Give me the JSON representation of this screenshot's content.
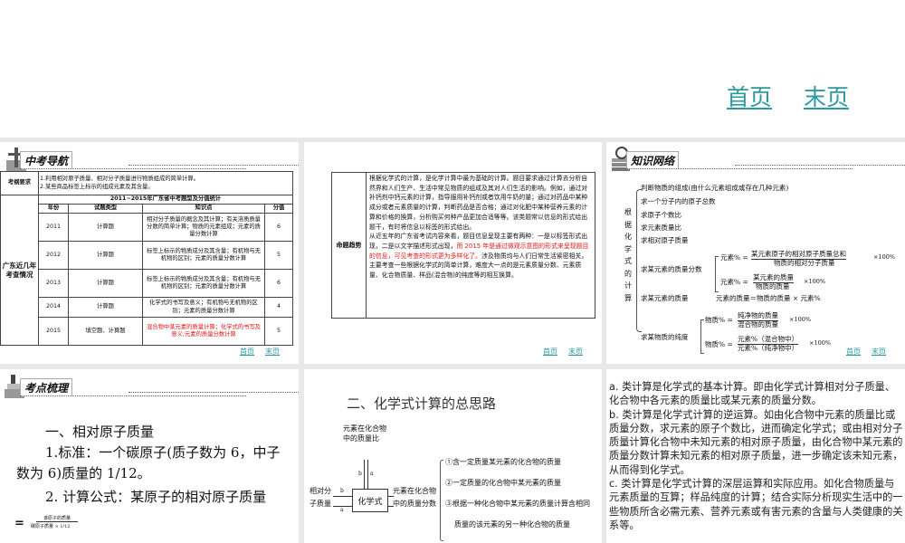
{
  "nav": {
    "first": "首页",
    "last": "末页"
  },
  "slide1": {
    "header": "中考导航",
    "req_label": "考纲要求",
    "req": [
      "1.利用相对原子质量、相对分子质量进行物质组成的简单计算。",
      "2.某些商品标签上标示的组成元素及其含量。"
    ],
    "side_label": "广东近几年考查情况",
    "table_title": "2011~2015年广东省中考题型及分值统计",
    "columns": [
      "年份",
      "试题类型",
      "知识点",
      "分值"
    ],
    "rows": [
      {
        "year": "2011",
        "type": "计算题",
        "point": "相对分子质量的概念及其计算；有关溶质质量分数的简单计算；物质的元素组成；元素的质量分数计算",
        "score": "6"
      },
      {
        "year": "2012",
        "type": "计算题",
        "point": "标签上标示的物质成分及其含量；有机物与无机物的区别；元素的质量分数计算",
        "score": "5"
      },
      {
        "year": "2013",
        "type": "计算题",
        "point": "标签上标示的物质成分及其含量；有机物与无机物的区别；元素的质量分数计算",
        "score": "6"
      },
      {
        "year": "2014",
        "type": "计算题",
        "point": "化学式的书写及意义；有机物与无机物的区别；元素的质量分数计算",
        "score": "4"
      },
      {
        "year": "2015",
        "type": "填空题、计算题",
        "point": "混合物中某元素的质量计算；化学式的书写及意义;元素的质量分数计算",
        "score": "5"
      }
    ]
  },
  "slide2": {
    "label": "命题趋势",
    "p1": "根据化学式的计算，是化学计算中最为基础的计算。题目要求通过计算去分析自然界和人们生产、生活中常见物质的组成及其对人们生活的影响。例如，通过对补钙剂中钙元素的计算，指导服用补钙剂或者饮用牛奶的量；通过对药品中某种成分或者元素质量的计算，判断药品是否合格；通过对化肥中某种营养元素的计算和价格的换算，分析购买何种产品更加合适等等。该类题常以信息的形式给出题干，有时将信息以标签的形式给出。",
    "p2a": "从近五年的广东省考试内容来看，题目信息呈现主要有两种：一是以标签形式出现，二是以文字描述形式出现，",
    "p2red": "而 2015 年是通过微观示意图的形式来呈现题目的信息，可见考查的形式更为多样化了。",
    "p2b": "涉及物质均与人们日常生活紧密相关，主要考查一些根据化学式的简单计算，难度大一点的是元素质量分数、元素质量、化合物质量、样品(混合物)的纯度等的相互换算。"
  },
  "slide3": {
    "header": "知识网络",
    "root": "根据化学式的计算",
    "items": [
      "判断物质的组成(由什么元素组成或存在几种元素)",
      "求一个分子内的原子总数",
      "求原子个数比",
      "求元素质量比",
      "求相对原子质量",
      "求某元素的质量分数",
      "求某元素的质量",
      "求某物质的纯度"
    ],
    "f1_lhs": "元素% =",
    "f1_num": "某元素原子的相对原子质量总和",
    "f1_den": "物质的相对分子质量",
    "f1_tail": "×100%",
    "f2_lhs": "元素% =",
    "f2_num": "某元素的质量",
    "f2_den": "物质的质量",
    "f2_tail": "×100%",
    "f3": "元素的质量＝物质的质量 × 元素%",
    "f4_lhs": "物质% =",
    "f4_num": "纯净物的质量",
    "f4_den": "混合物的质量",
    "f4_tail": "×100%",
    "f5_lhs": "物质% =",
    "f5_num": "元素%（混合物中）",
    "f5_den": "元素%（纯净物中）",
    "f5_tail": "×100%"
  },
  "slide4": {
    "header": "考点梳理",
    "h1": "一、相对原子质量",
    "l1": "1.标准：一个碳原子(质子数为 6，中子",
    "l2": "数为 6)质量的 1/12。",
    "l3a": "2. 计算公式：",
    "l3b": "某原子的相对原子质量",
    "eq": "=",
    "num": "该原子的质量",
    "den": "碳原子质量 × 1/12"
  },
  "slide5": {
    "title": "二、化学式计算的总思路",
    "top": "元素在化合物中的质量比",
    "left": "相对分子质量",
    "center": "化学式",
    "right": "元素在化合物中的质量分数",
    "a": "a",
    "b": "b",
    "items": [
      "①含一定质量某元素的化合物的质量",
      "②一定质量的化合物中某元素的质量",
      "③根据一种化合物中某元素的质量计算含相同",
      "质量的该元素的另一种化合物的质量"
    ]
  },
  "slide6": {
    "text": [
      "a. 类计算是化学式的基本计算。即由化学式计算相对分子质量、化合物中各元素的质量比或某元素的质量分数。",
      "b. 类计算是化学式计算的逆运算。如由化合物中元素的质量比或质量分数，求元素的原子个数比，进而确定化学式；或由相对分子质量计算化合物中未知元素的相对原子质量，由化合物中某元素的质量分数计算未知元素的相对原子质量，进一步确定该未知元素，从而得到化学式。",
      "c. 类计算是化学式计算的深层运算和实际应用。如化合物质量与元素质量的互算；样品纯度的计算；结合实际分析现实生活中的一些物质所含必需元素、营养元素或有害元素的含量与人类健康的关系等。"
    ]
  }
}
